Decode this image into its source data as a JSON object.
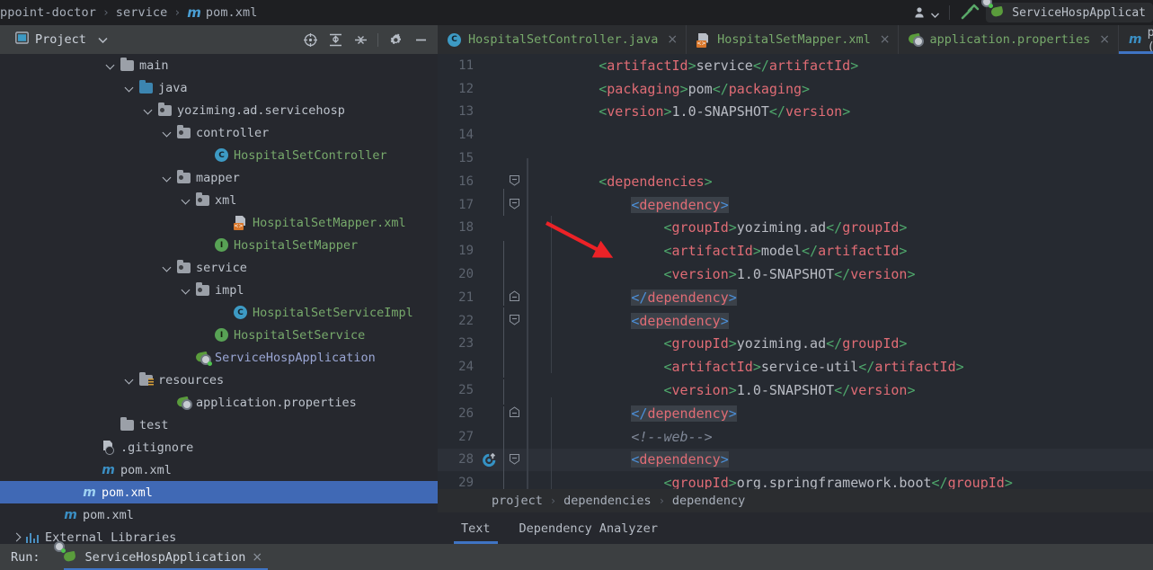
{
  "topbar": {
    "breadcrumb": [
      "ppoint-doctor",
      "service",
      "pom.xml"
    ],
    "maven_icon": "maven-m-icon",
    "user_icon": "user-account-icon",
    "user_chevron": "chevron-down-icon",
    "build_icon": "build-hammer-icon",
    "run_config": "ServiceHospApplicat",
    "run_config_icon": "spring-boot-icon"
  },
  "project_panel": {
    "title": "Project",
    "title_icon": "project-view-icon",
    "chevron": "chevron-down-icon",
    "tools": [
      {
        "name": "locate-icon",
        "title": "Select Opened File"
      },
      {
        "name": "expand-all-icon",
        "title": "Expand All"
      },
      {
        "name": "collapse-all-icon",
        "title": "Collapse All"
      },
      {
        "name": "settings-gear-icon",
        "title": "Options"
      },
      {
        "name": "minimize-icon",
        "title": "Hide"
      }
    ]
  },
  "tree": [
    {
      "label": "main",
      "indent": 5,
      "chevron": "down",
      "icon": "folder-gray",
      "style": "plain"
    },
    {
      "label": "java",
      "indent": 6,
      "chevron": "down",
      "icon": "folder-source-blue",
      "style": "plain"
    },
    {
      "label": "yoziming.ad.servicehosp",
      "indent": 7,
      "chevron": "down",
      "icon": "folder-package",
      "style": "plain"
    },
    {
      "label": "controller",
      "indent": 8,
      "chevron": "down",
      "icon": "folder-package",
      "style": "plain"
    },
    {
      "label": "HospitalSetController",
      "indent": 10,
      "chevron": "none",
      "icon": "class-c",
      "style": "green"
    },
    {
      "label": "mapper",
      "indent": 8,
      "chevron": "down",
      "icon": "folder-package",
      "style": "plain"
    },
    {
      "label": "xml",
      "indent": 9,
      "chevron": "down",
      "icon": "folder-package",
      "style": "plain"
    },
    {
      "label": "HospitalSetMapper.xml",
      "indent": 11,
      "chevron": "none",
      "icon": "xml-file",
      "style": "green"
    },
    {
      "label": "HospitalSetMapper",
      "indent": 10,
      "chevron": "none",
      "icon": "interface-i",
      "style": "green"
    },
    {
      "label": "service",
      "indent": 8,
      "chevron": "down",
      "icon": "folder-package",
      "style": "plain"
    },
    {
      "label": "impl",
      "indent": 9,
      "chevron": "down",
      "icon": "folder-package",
      "style": "plain"
    },
    {
      "label": "HospitalSetServiceImpl",
      "indent": 11,
      "chevron": "none",
      "icon": "class-c",
      "style": "green"
    },
    {
      "label": "HospitalSetService",
      "indent": 10,
      "chevron": "none",
      "icon": "interface-i",
      "style": "green"
    },
    {
      "label": "ServiceHospApplication",
      "indent": 9,
      "chevron": "none",
      "icon": "spring-boot",
      "style": "lavender"
    },
    {
      "label": "resources",
      "indent": 6,
      "chevron": "down",
      "icon": "folder-resources",
      "style": "plain"
    },
    {
      "label": "application.properties",
      "indent": 8,
      "chevron": "none",
      "icon": "spring-properties",
      "style": "plain"
    },
    {
      "label": "test",
      "indent": 5,
      "chevron": "none",
      "icon": "folder-gray",
      "style": "plain"
    },
    {
      "label": ".gitignore",
      "indent": 4,
      "chevron": "none",
      "icon": "gitignore-file",
      "style": "plain"
    },
    {
      "label": "pom.xml",
      "indent": 4,
      "chevron": "none",
      "icon": "maven-m",
      "style": "plain"
    },
    {
      "label": "pom.xml",
      "indent": 3,
      "chevron": "none",
      "icon": "maven-m",
      "style": "plain",
      "selected": true
    },
    {
      "label": "pom.xml",
      "indent": 2,
      "chevron": "none",
      "icon": "maven-m",
      "style": "plain"
    },
    {
      "label": "External Libraries",
      "indent": 0,
      "chevron": "right",
      "icon": "libraries",
      "style": "plain"
    }
  ],
  "editor_tabs": [
    {
      "label": "HospitalSetController.java",
      "icon": "class-c-icon",
      "close": "×",
      "active": false
    },
    {
      "label": "HospitalSetMapper.xml",
      "icon": "xml-file-icon",
      "close": "×",
      "active": false
    },
    {
      "label": "application.properties",
      "icon": "spring-properties-icon",
      "close": "×",
      "active": false
    },
    {
      "label": "pom.xml (service)",
      "icon": "maven-m-icon",
      "close": "",
      "active": true
    }
  ],
  "editor": {
    "lines": [
      {
        "num": "11",
        "indent": 2,
        "tokens": [
          [
            "br",
            "<"
          ],
          [
            "tg",
            "artifactId"
          ],
          [
            "br",
            ">"
          ],
          [
            "txt",
            "service"
          ],
          [
            "br",
            "</"
          ],
          [
            "tg",
            "artifactId"
          ],
          [
            "br",
            ">"
          ]
        ]
      },
      {
        "num": "12",
        "indent": 2,
        "tokens": [
          [
            "br",
            "<"
          ],
          [
            "tg",
            "packaging"
          ],
          [
            "br",
            ">"
          ],
          [
            "txt",
            "pom"
          ],
          [
            "br",
            "</"
          ],
          [
            "tg",
            "packaging"
          ],
          [
            "br",
            ">"
          ]
        ]
      },
      {
        "num": "13",
        "indent": 2,
        "tokens": [
          [
            "br",
            "<"
          ],
          [
            "tg",
            "version"
          ],
          [
            "br",
            ">"
          ],
          [
            "txt",
            "1.0-SNAPSHOT"
          ],
          [
            "br",
            "</"
          ],
          [
            "tg",
            "version"
          ],
          [
            "br",
            ">"
          ]
        ]
      },
      {
        "num": "14",
        "indent": 0,
        "tokens": []
      },
      {
        "num": "15",
        "indent": 0,
        "tokens": []
      },
      {
        "num": "16",
        "indent": 2,
        "fold": "start",
        "tokens": [
          [
            "br",
            "<"
          ],
          [
            "tg",
            "dependencies"
          ],
          [
            "br",
            ">"
          ]
        ]
      },
      {
        "num": "17",
        "indent": 3,
        "fold": "start",
        "tokens": [
          [
            "brb hl",
            "<"
          ],
          [
            "tg hl",
            "dependency"
          ],
          [
            "brb hl",
            ">"
          ]
        ]
      },
      {
        "num": "18",
        "indent": 4,
        "tokens": [
          [
            "br",
            "<"
          ],
          [
            "tg",
            "groupId"
          ],
          [
            "br",
            ">"
          ],
          [
            "txt",
            "yoziming.ad"
          ],
          [
            "br",
            "</"
          ],
          [
            "tg",
            "groupId"
          ],
          [
            "br",
            ">"
          ]
        ]
      },
      {
        "num": "19",
        "indent": 4,
        "tokens": [
          [
            "br",
            "<"
          ],
          [
            "tg",
            "artifactId"
          ],
          [
            "br",
            ">"
          ],
          [
            "txt",
            "model"
          ],
          [
            "br",
            "</"
          ],
          [
            "tg",
            "artifactId"
          ],
          [
            "br",
            ">"
          ]
        ]
      },
      {
        "num": "20",
        "indent": 4,
        "tokens": [
          [
            "br",
            "<"
          ],
          [
            "tg",
            "version"
          ],
          [
            "br",
            ">"
          ],
          [
            "txt",
            "1.0-SNAPSHOT"
          ],
          [
            "br",
            "</"
          ],
          [
            "tg",
            "version"
          ],
          [
            "br",
            ">"
          ]
        ]
      },
      {
        "num": "21",
        "indent": 3,
        "fold": "end",
        "tokens": [
          [
            "brb hl",
            "</"
          ],
          [
            "tg hl",
            "dependency"
          ],
          [
            "brb hl",
            ">"
          ]
        ]
      },
      {
        "num": "22",
        "indent": 3,
        "fold": "start",
        "tokens": [
          [
            "brb hl",
            "<"
          ],
          [
            "tg hl",
            "dependency"
          ],
          [
            "brb hl",
            ">"
          ]
        ]
      },
      {
        "num": "23",
        "indent": 4,
        "tokens": [
          [
            "br",
            "<"
          ],
          [
            "tg",
            "groupId"
          ],
          [
            "br",
            ">"
          ],
          [
            "txt",
            "yoziming.ad"
          ],
          [
            "br",
            "</"
          ],
          [
            "tg",
            "groupId"
          ],
          [
            "br",
            ">"
          ]
        ]
      },
      {
        "num": "24",
        "indent": 4,
        "tokens": [
          [
            "br",
            "<"
          ],
          [
            "tg",
            "artifactId"
          ],
          [
            "br",
            ">"
          ],
          [
            "txt",
            "service-util"
          ],
          [
            "br",
            "</"
          ],
          [
            "tg",
            "artifactId"
          ],
          [
            "br",
            ">"
          ]
        ]
      },
      {
        "num": "25",
        "indent": 4,
        "tokens": [
          [
            "br",
            "<"
          ],
          [
            "tg",
            "version"
          ],
          [
            "br",
            ">"
          ],
          [
            "txt",
            "1.0-SNAPSHOT"
          ],
          [
            "br",
            "</"
          ],
          [
            "tg",
            "version"
          ],
          [
            "br",
            ">"
          ]
        ]
      },
      {
        "num": "26",
        "indent": 3,
        "fold": "end",
        "tokens": [
          [
            "brb hl",
            "</"
          ],
          [
            "tg hl",
            "dependency"
          ],
          [
            "brb hl",
            ">"
          ]
        ]
      },
      {
        "num": "27",
        "indent": 3,
        "tokens": [
          [
            "cmt",
            "<!--web-->"
          ]
        ]
      },
      {
        "num": "28",
        "indent": 3,
        "fold": "start",
        "current": true,
        "gutter_icon": "maven-reload-icon",
        "tokens": [
          [
            "brb hl",
            "<"
          ],
          [
            "tg hl",
            "dependency"
          ],
          [
            "brb hl",
            ">"
          ]
        ]
      },
      {
        "num": "29",
        "indent": 4,
        "clipped": true,
        "tokens": [
          [
            "br",
            "<"
          ],
          [
            "tg",
            "groupId"
          ],
          [
            "br",
            ">"
          ],
          [
            "txt",
            "org.springframework.boot"
          ],
          [
            "br",
            "</"
          ],
          [
            "tg",
            "groupId"
          ],
          [
            "br",
            ">"
          ]
        ]
      }
    ],
    "breadcrumb": [
      "project",
      "dependencies",
      "dependency"
    ],
    "bottom_tabs": [
      {
        "label": "Text",
        "active": true
      },
      {
        "label": "Dependency Analyzer",
        "active": false
      }
    ],
    "annotation": {
      "type": "red-arrow",
      "color": "#ec2227",
      "points_to_line": "19"
    }
  },
  "runbar": {
    "label": "Run:",
    "tab_label": "ServiceHospApplication",
    "tab_icon": "spring-boot-icon",
    "close": "×"
  },
  "colors": {
    "bg": "#2b2d30",
    "editor_bg": "#262a31",
    "tree_bg": "#26282e",
    "selection": "#4069b5",
    "accent": "#3f74c4",
    "tag": "#e06c75",
    "bracket_green": "#4fa86c",
    "bracket_blue": "#4c8fd8",
    "text_green": "#77a96b",
    "annotation_red": "#ec2227"
  }
}
